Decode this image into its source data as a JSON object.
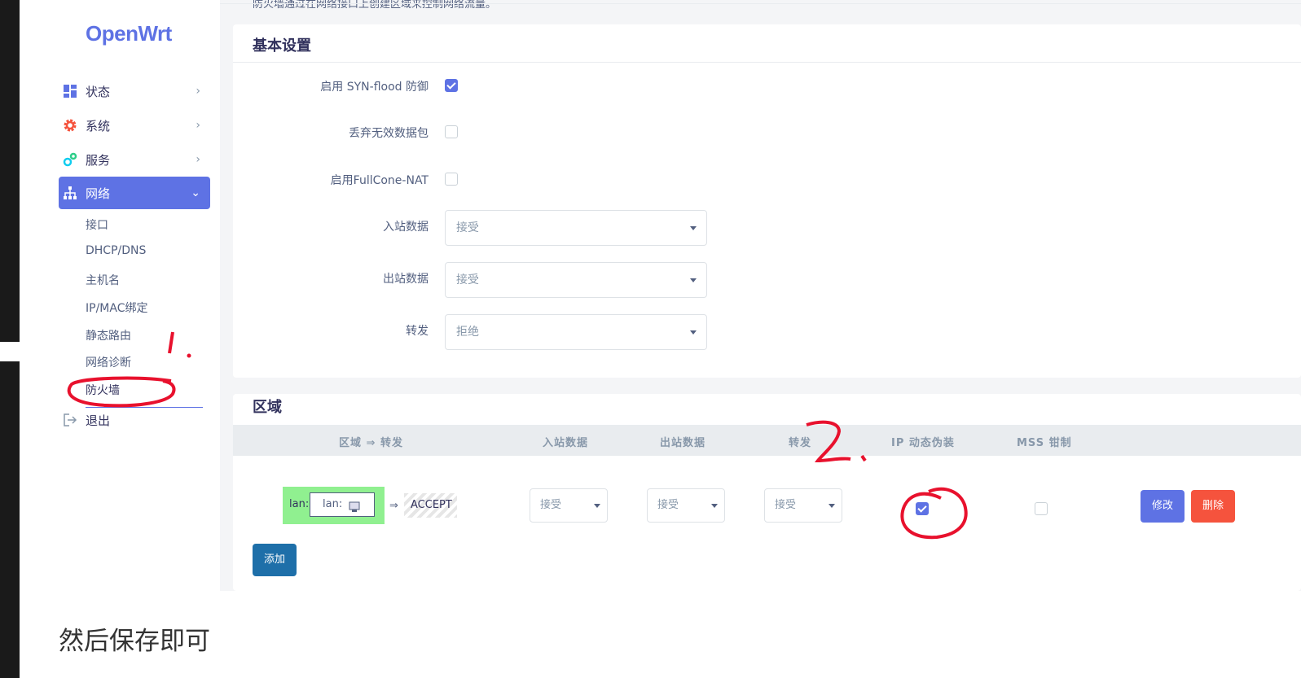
{
  "logo": "OpenWrt",
  "sidebar": {
    "items": [
      {
        "label": "状态",
        "icon": "dashboard-icon"
      },
      {
        "label": "系统",
        "icon": "gear-icon"
      },
      {
        "label": "服务",
        "icon": "cogs-icon"
      },
      {
        "label": "网络",
        "icon": "network-icon"
      }
    ],
    "network_sub": [
      "接口",
      "DHCP/DNS",
      "主机名",
      "IP/MAC绑定",
      "静态路由",
      "网络诊断",
      "防火墙"
    ],
    "logout": "退出"
  },
  "top_text": "防火墙通过在网络接口上创建区域来控制网络流量。",
  "basic": {
    "title": "基本设置",
    "syn_flood_label": "启用 SYN-flood 防御",
    "syn_flood_checked": true,
    "drop_invalid_label": "丢弃无效数据包",
    "drop_invalid_checked": false,
    "fullcone_label": "启用FullCone-NAT",
    "fullcone_checked": false,
    "input_label": "入站数据",
    "input_value": "接受",
    "output_label": "出站数据",
    "output_value": "接受",
    "forward_label": "转发",
    "forward_value": "拒绝"
  },
  "zones": {
    "title": "区域",
    "headers": [
      "区域 ⇒ 转发",
      "入站数据",
      "出站数据",
      "转发",
      "IP 动态伪装",
      "MSS 钳制"
    ],
    "row": {
      "zone_name": "lan:",
      "zone_iface": "lan:",
      "arrow": "⇒",
      "dest": "ACCEPT",
      "input": "接受",
      "output": "接受",
      "forward": "接受",
      "masq_checked": true,
      "mss_checked": false
    },
    "edit_label": "修改",
    "delete_label": "删除",
    "add_label": "添加"
  },
  "annotations": [
    "1.",
    "2."
  ],
  "caption": "然后保存即可",
  "colors": {
    "accent": "#5e72e4",
    "danger": "#f5533d",
    "add_button": "#1e6fa9",
    "zone_lan": "#90f090",
    "annotation": "#e8112d"
  }
}
